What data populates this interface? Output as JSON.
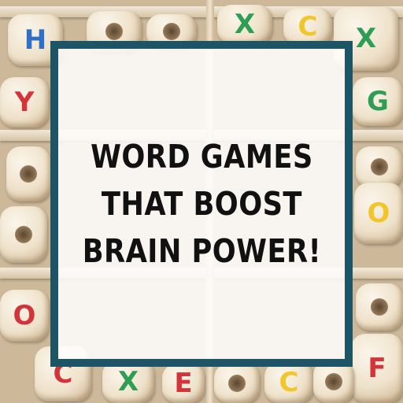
{
  "headline": {
    "line1": "WORD GAMES",
    "line2": "THAT BOOST",
    "line3": "BRAIN POWER!"
  },
  "colors": {
    "frame": "#1e5566",
    "text": "#111111",
    "letter_blue": "#2f6fc4",
    "letter_green": "#2e9e55",
    "letter_red": "#d3343a",
    "letter_yellow": "#f1c629"
  },
  "background": {
    "subject": "wooden-letter-beads-in-tray-icon"
  }
}
